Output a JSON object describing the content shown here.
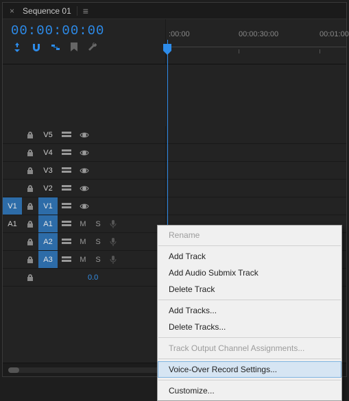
{
  "panel": {
    "title": "Sequence 01"
  },
  "timecode": "00:00:00:00",
  "ruler": {
    "t0": ":00:00",
    "t1": "00:00:30:00",
    "t2": "00:01:00"
  },
  "video_tracks": [
    {
      "src": "",
      "src_on": false,
      "label": "V5",
      "label_on": false
    },
    {
      "src": "",
      "src_on": false,
      "label": "V4",
      "label_on": false
    },
    {
      "src": "",
      "src_on": false,
      "label": "V3",
      "label_on": false
    },
    {
      "src": "",
      "src_on": false,
      "label": "V2",
      "label_on": false
    },
    {
      "src": "V1",
      "src_on": true,
      "label": "V1",
      "label_on": true
    }
  ],
  "audio_tracks": [
    {
      "src": "A1",
      "src_on": false,
      "label": "A1",
      "label_on": true,
      "mute": "M",
      "solo": "S"
    },
    {
      "src": "",
      "src_on": false,
      "label": "A2",
      "label_on": true,
      "mute": "M",
      "solo": "S"
    },
    {
      "src": "",
      "src_on": false,
      "label": "A3",
      "label_on": true,
      "mute": "M",
      "solo": "S"
    }
  ],
  "summary_value": "0.0",
  "context_menu": {
    "rename": "Rename",
    "add_track": "Add Track",
    "add_submix": "Add Audio Submix Track",
    "delete_track": "Delete Track",
    "add_tracks": "Add Tracks...",
    "delete_tracks": "Delete Tracks...",
    "assignments": "Track Output Channel Assignments...",
    "vo_settings": "Voice-Over Record Settings...",
    "customize": "Customize..."
  }
}
